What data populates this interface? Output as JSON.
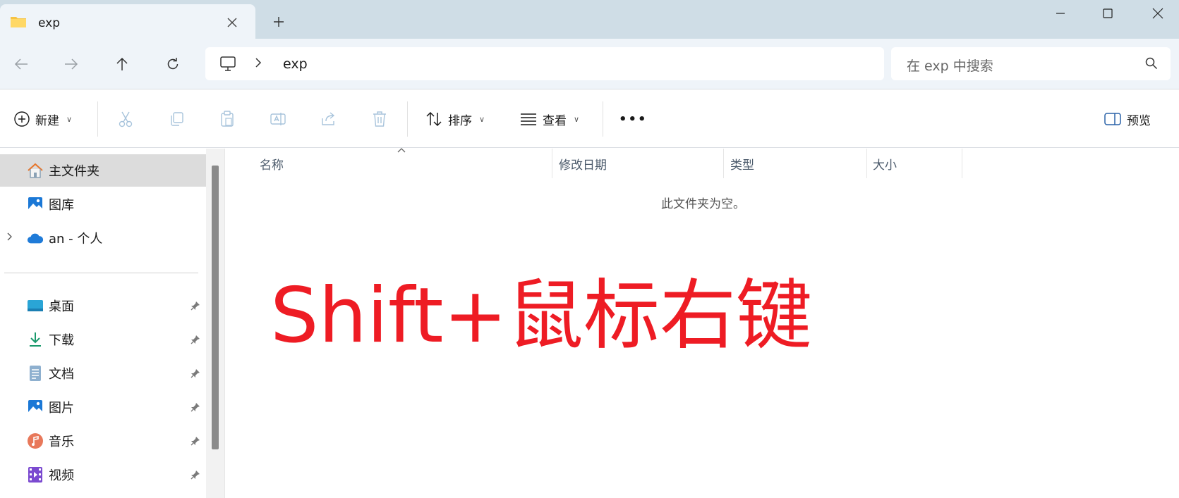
{
  "tab": {
    "title": "exp"
  },
  "address": {
    "path_segment": "exp"
  },
  "search": {
    "placeholder": "在 exp 中搜索"
  },
  "toolbar": {
    "new_label": "新建",
    "sort_label": "排序",
    "view_label": "查看",
    "more_label": "•••",
    "preview_label": "预览"
  },
  "sidebar": {
    "items": [
      {
        "label": "主文件夹",
        "icon": "home-icon"
      },
      {
        "label": "图库",
        "icon": "gallery-icon"
      },
      {
        "label": "an - 个人",
        "icon": "onedrive-cloud-icon"
      },
      {
        "label": "桌面",
        "icon": "desktop-icon"
      },
      {
        "label": "下载",
        "icon": "download-icon"
      },
      {
        "label": "文档",
        "icon": "documents-icon"
      },
      {
        "label": "图片",
        "icon": "pictures-icon"
      },
      {
        "label": "音乐",
        "icon": "music-icon"
      },
      {
        "label": "视频",
        "icon": "videos-icon"
      }
    ]
  },
  "columns": [
    "名称",
    "修改日期",
    "类型",
    "大小"
  ],
  "empty_message": "此文件夹为空。",
  "overlay_text": "Shift+鼠标右键",
  "colors": {
    "overlay": "#ee1c24",
    "titlebar": "#cfdde6",
    "navbar": "#eff4f9",
    "selected": "#dcdcdc"
  }
}
